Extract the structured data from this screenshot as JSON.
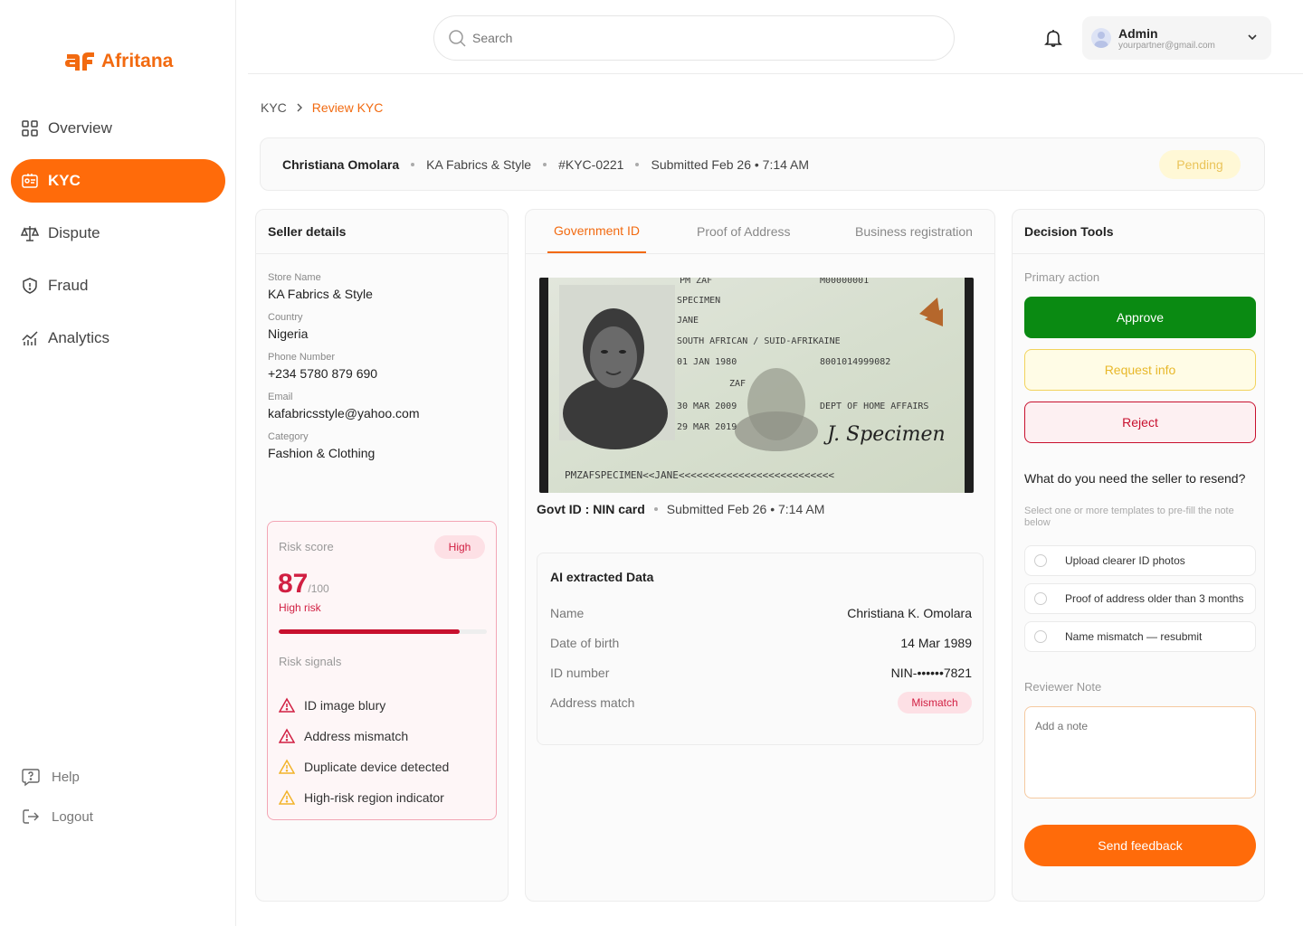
{
  "brand": {
    "name": "Afritana",
    "color": "#f26a10"
  },
  "sidebar": {
    "items": [
      {
        "label": "Overview",
        "icon": "grid-icon"
      },
      {
        "label": "KYC",
        "icon": "id-card-icon",
        "active": true
      },
      {
        "label": "Dispute",
        "icon": "scale-icon"
      },
      {
        "label": "Fraud",
        "icon": "shield-icon"
      },
      {
        "label": "Analytics",
        "icon": "chart-icon"
      }
    ],
    "bottom": [
      {
        "label": "Help",
        "icon": "help-icon"
      },
      {
        "label": "Logout",
        "icon": "logout-icon"
      }
    ]
  },
  "topbar": {
    "search_placeholder": "Search",
    "user": {
      "name": "Admin",
      "email": "yourpartner@gmail.com"
    }
  },
  "breadcrumb": {
    "parent": "KYC",
    "current": "Review KYC"
  },
  "header": {
    "seller_name": "Christiana Omolara",
    "store": "KA Fabrics & Style",
    "kyc_id": "#KYC-0221",
    "submitted": "Submitted Feb 26 • 7:14 AM",
    "status": "Pending"
  },
  "seller": {
    "title": "Seller details",
    "fields": [
      {
        "label": "Store Name",
        "value": "KA Fabrics & Style"
      },
      {
        "label": "Country",
        "value": "Nigeria"
      },
      {
        "label": "Phone Number",
        "value": "+234 5780 879 690"
      },
      {
        "label": "Email",
        "value": "kafabricsstyle@yahoo.com"
      },
      {
        "label": "Category",
        "value": "Fashion & Clothing"
      }
    ],
    "risk": {
      "label": "Risk score",
      "badge": "High",
      "score": "87",
      "max": "/100",
      "score_fraction": 0.87,
      "level": "High risk",
      "signals_label": "Risk signals",
      "signals": [
        {
          "text": "ID image blury",
          "severity": "high",
          "color": "#d11f42"
        },
        {
          "text": "Address mismatch",
          "severity": "high",
          "color": "#d11f42"
        },
        {
          "text": "Duplicate device detected",
          "severity": "medium",
          "color": "#f2b32a"
        },
        {
          "text": "High-risk region indicator",
          "severity": "medium",
          "color": "#f2b32a"
        }
      ]
    }
  },
  "documents": {
    "tabs": [
      "Government ID",
      "Proof of Address",
      "Business registration"
    ],
    "active_tab": 0,
    "id_card": {
      "text_lines": [
        "SPECIMEN",
        "JANE",
        "SOUTH AFRICAN / SUID-AFRIKAINE",
        "01 JAN 1980",
        "ZAF",
        "30 MAR 2009",
        "29 MAR 2019",
        "DEPT OF HOME AFFAIRS",
        "PMZAFSPECIMEN<<JANE<<<<<<<<<<<<<<<<<<<<<<<<<<"
      ],
      "signature": "J. Specimen"
    },
    "caption_type": "Govt ID : NIN card",
    "caption_submitted": "Submitted Feb 26 • 7:14 AM",
    "ai": {
      "title": "AI extracted Data",
      "rows": [
        {
          "key": "Name",
          "value": "Christiana  K. Omolara"
        },
        {
          "key": "Date of birth",
          "value": "14 Mar 1989"
        },
        {
          "key": "ID number",
          "value": "NIN-••••••7821"
        },
        {
          "key": "Address match",
          "value": "Mismatch",
          "badge": true
        }
      ]
    }
  },
  "decision": {
    "title": "Decision Tools",
    "primary_label": "Primary action",
    "approve": "Approve",
    "request_info": "Request info",
    "reject": "Reject",
    "question": "What do you need the seller to resend?",
    "hint": "Select one or more templates to pre-fill the note below",
    "templates": [
      "Upload clearer ID photos",
      "Proof of address older than 3 months",
      "Name mismatch — resubmit"
    ],
    "note_label": "Reviewer Note",
    "note_placeholder": "Add a note",
    "send": "Send feedback"
  }
}
